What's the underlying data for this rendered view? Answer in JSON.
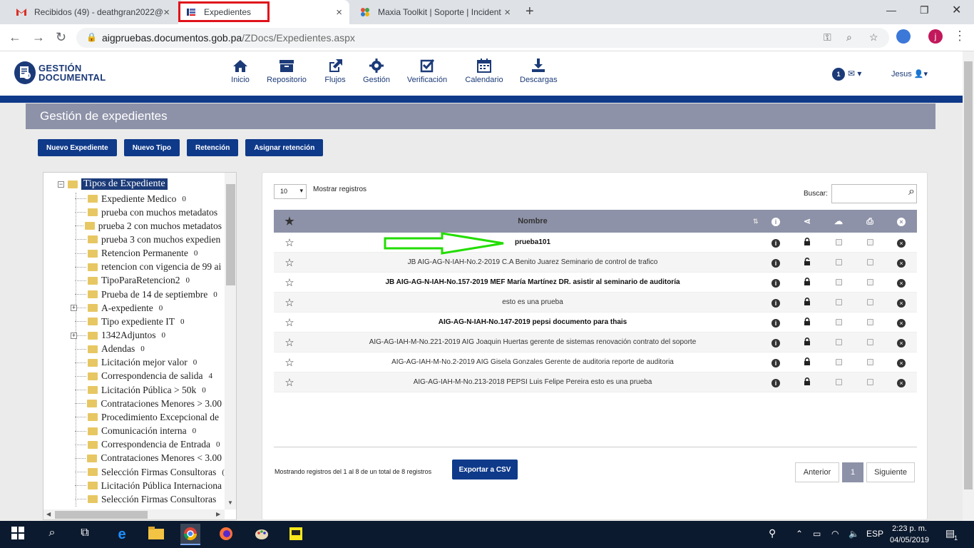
{
  "browser": {
    "tabs": [
      {
        "label": "Recibidos (49) - deathgran2022@",
        "icon": "gmail-icon"
      },
      {
        "label": "Expedientes",
        "icon": "site-icon"
      },
      {
        "label": "Maxia Toolkit | Soporte | Incident",
        "icon": "maxia-icon"
      }
    ],
    "url_host": "aigpruebas.documentos.gob.pa",
    "url_path": "/ZDocs/Expedientes.aspx",
    "profile_initial": "j"
  },
  "app": {
    "logo_line1": "GESTIÓN",
    "logo_line2": "DOCUMENTAL",
    "nav": [
      {
        "label": "Inicio",
        "icon": "home-icon"
      },
      {
        "label": "Repositorio",
        "icon": "archive-icon"
      },
      {
        "label": "Flujos",
        "icon": "external-link-icon"
      },
      {
        "label": "Gestión",
        "icon": "gear-icon"
      },
      {
        "label": "Verificación",
        "icon": "check-square-icon"
      },
      {
        "label": "Calendario",
        "icon": "calendar-icon"
      },
      {
        "label": "Descargas",
        "icon": "download-icon"
      }
    ],
    "notification_count": "1",
    "user_name": "Jesus",
    "page_title": "Gestión de expedientes",
    "actions": [
      "Nuevo Expediente",
      "Nuevo Tipo",
      "Retención",
      "Asignar retención"
    ]
  },
  "tree": {
    "root": "Tipos de Expediente",
    "items": [
      {
        "label": "Expediente Medico",
        "count": "0"
      },
      {
        "label": "prueba con muchos metadatos",
        "count": ""
      },
      {
        "label": "prueba 2 con muchos metadatos",
        "count": ""
      },
      {
        "label": "prueba 3 con muchos expedien",
        "count": ""
      },
      {
        "label": "Retencion Permanente",
        "count": "0"
      },
      {
        "label": "retencion con vigencia de 99 ai",
        "count": ""
      },
      {
        "label": "TipoParaRetencion2",
        "count": "0"
      },
      {
        "label": "Prueba de 14 de septiembre",
        "count": "0"
      },
      {
        "label": "A-expediente",
        "count": "0"
      },
      {
        "label": "Tipo expediente IT",
        "count": "0"
      },
      {
        "label": "1342Adjuntos",
        "count": "0"
      },
      {
        "label": "Adendas",
        "count": "0"
      },
      {
        "label": "Licitación mejor valor",
        "count": "0"
      },
      {
        "label": "Correspondencia de salida",
        "count": "4"
      },
      {
        "label": "Licitación Pública > 50k",
        "count": "0"
      },
      {
        "label": "Contrataciones Menores > 3.00",
        "count": ""
      },
      {
        "label": "Procedimiento Excepcional de",
        "count": ""
      },
      {
        "label": "Comunicación interna",
        "count": "0"
      },
      {
        "label": "Correspondencia de Entrada",
        "count": "0"
      },
      {
        "label": "Contrataciones Menores < 3.00",
        "count": ""
      },
      {
        "label": "Selección Firmas Consultoras",
        "count": "("
      },
      {
        "label": "Licitación Pública Internaciona",
        "count": ""
      },
      {
        "label": "Selección Firmas Consultoras",
        "count": ""
      }
    ]
  },
  "list": {
    "page_length": "10",
    "length_label": "Mostrar registros",
    "search_label": "Buscar:",
    "search_value": "",
    "column_name": "Nombre",
    "rows": [
      {
        "name": "prueba101",
        "bold": true,
        "locked": true
      },
      {
        "name": "JB AIG-AG-N-IAH-No.2-2019 C.A Benito Juarez Seminario de control de trafico",
        "bold": false,
        "locked": false
      },
      {
        "name": "JB AIG-AG-N-IAH-No.157-2019 MEF María Martínez DR. asistir al seminario de auditoría",
        "bold": true,
        "locked": true
      },
      {
        "name": "esto es una prueba",
        "bold": false,
        "locked": true
      },
      {
        "name": "AIG-AG-N-IAH-No.147-2019 pepsi documento para thais",
        "bold": true,
        "locked": true
      },
      {
        "name": "AIG-AG-IAH-M-No.221-2019 AIG Joaquin Huertas gerente de sistemas renovación contrato del soporte",
        "bold": false,
        "locked": true
      },
      {
        "name": "AIG-AG-IAH-M-No.2-2019 AIG Gisela Gonzales Gerente de auditoria reporte de auditoria",
        "bold": false,
        "locked": true
      },
      {
        "name": "AIG-AG-IAH-M-No.213-2018 PEPSI Luis Felipe Pereira esto es una prueba",
        "bold": false,
        "locked": true
      }
    ],
    "summary": "Mostrando registros del 1 al 8 de un total de 8 registros",
    "export_label": "Exportar a CSV",
    "prev_label": "Anterior",
    "current_page": "1",
    "next_label": "Siguiente"
  },
  "taskbar": {
    "lang": "ESP",
    "time": "2:23 p. m.",
    "date": "04/05/2019",
    "notif_count": "1"
  },
  "colors": {
    "brand": "#0f3a8a",
    "header_band": "#8e92a8",
    "annotation_arrow": "#22dd00"
  }
}
